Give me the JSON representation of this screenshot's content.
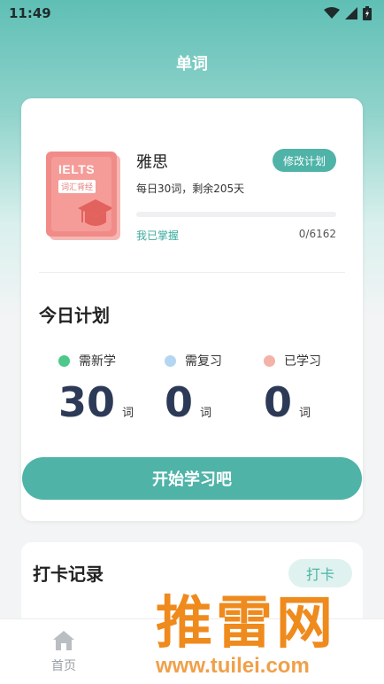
{
  "status_bar": {
    "time": "11:49"
  },
  "header": {
    "title": "单词"
  },
  "plan_card": {
    "book": {
      "title": "IELTS",
      "subtitle": "词汇背经"
    },
    "name": "雅思",
    "edit_label": "修改计划",
    "daily_info": "每日30词，剩余205天",
    "mastered_label": "我已掌握",
    "mastered_count": "0/6162",
    "progress": 0
  },
  "today_plan": {
    "title": "今日计划",
    "items": [
      {
        "label": "需新学",
        "count": "30",
        "unit": "词",
        "color": "#4cc98a"
      },
      {
        "label": "需复习",
        "count": "0",
        "unit": "词",
        "color": "#b5d6f2"
      },
      {
        "label": "已学习",
        "count": "0",
        "unit": "词",
        "color": "#f4b3a8"
      }
    ],
    "start_label": "开始学习吧"
  },
  "checkin_card": {
    "title": "打卡记录",
    "button_label": "打卡"
  },
  "bottom_nav": {
    "items": [
      {
        "label": "首页",
        "icon": "home-icon"
      }
    ]
  },
  "watermark": {
    "text": "推雷网",
    "url": "www.tuilei.com"
  },
  "colors": {
    "accent": "#4fb3a8",
    "count_text": "#2c3a57",
    "book": "#f18b88"
  }
}
